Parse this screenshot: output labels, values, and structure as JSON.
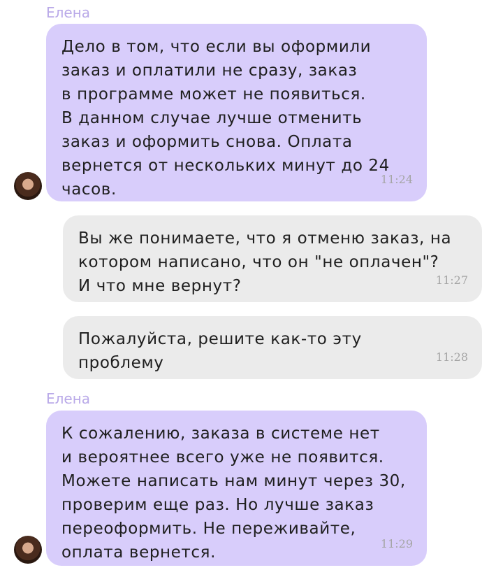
{
  "messages": [
    {
      "direction": "incoming",
      "sender": "Елена",
      "lines": [
        "Дело в том, что если вы оформили",
        "заказ и оплатили не сразу, заказ",
        "в программе может не появиться.",
        "В данном случае лучше отменить",
        "заказ и оформить снова. Оплата",
        "вернется от нескольких минут до 24",
        "часов."
      ],
      "time": "11:24"
    },
    {
      "direction": "outgoing",
      "lines": [
        "Вы же понимаете, что я отменю заказ, на",
        "котором написано, что он \"не оплачен\"?",
        "И что мне вернут?"
      ],
      "time": "11:27"
    },
    {
      "direction": "outgoing",
      "lines": [
        "Пожалуйста, решите как-то эту",
        "проблему"
      ],
      "time": "11:28"
    },
    {
      "direction": "incoming",
      "sender": "Елена",
      "lines": [
        "К сожалению, заказа в системе нет",
        "и вероятнее всего уже не появится.",
        "Можете написать нам минут через 30,",
        "проверим еще раз. Но лучше заказ",
        "переоформить. Не переживайте,",
        "оплата вернется."
      ],
      "time": "11:29"
    }
  ],
  "colors": {
    "incoming_bubble": "#d8cdfb",
    "outgoing_bubble": "#ebebeb",
    "sender_name": "#b9a9e8",
    "timestamp": "#a5a5a5"
  },
  "icons": {
    "avatar": "agent-avatar"
  }
}
